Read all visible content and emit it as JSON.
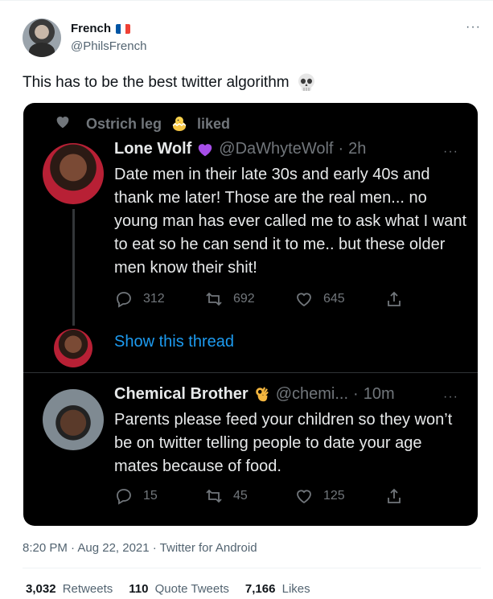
{
  "author": {
    "name": "French",
    "handle": "@PhilsFrench",
    "more": "···"
  },
  "tweet": {
    "text": "This has to be the best twitter algorithm"
  },
  "embedded": {
    "liked": {
      "user": "Ostrich leg",
      "action": "liked"
    },
    "first": {
      "name": "Lone Wolf",
      "handle": "@DaWhyteWolf",
      "dot": "·",
      "time": "2h",
      "more": "···",
      "text": "Date men in their late 30s and early 40s and thank me later! Those are the real men... no young man has ever called me to ask what I want to eat so he can send it to me.. but these older men know their shit!",
      "replies": "312",
      "retweets": "692",
      "likes": "645",
      "show_thread": "Show this thread"
    },
    "second": {
      "name": "Chemical Brother",
      "handle": "@chemi...",
      "dot": "·",
      "time": "10m",
      "more": "···",
      "text": "Parents please feed your children so they won’t be on twitter telling people to date your age mates because of food.",
      "replies": "15",
      "retweets": "45",
      "likes": "125"
    }
  },
  "meta": {
    "timestamp": "8:20 PM · Aug 22, 2021 · Twitter for Android"
  },
  "stats": {
    "retweets_count": "3,032",
    "retweets_label": "Retweets",
    "quotes_count": "110",
    "quotes_label": "Quote Tweets",
    "likes_count": "7,166",
    "likes_label": "Likes"
  },
  "colors": {
    "accent": "#1d9bf0",
    "dark_bg": "#000000",
    "muted": "#536471"
  },
  "icons": [
    "flag-france-icon",
    "skull-emoji-icon",
    "heart-icon",
    "chick-emoji-icon",
    "purple-heart-emoji-icon",
    "ok-hand-emoji-icon",
    "reply-icon",
    "retweet-icon",
    "share-icon",
    "more-icon"
  ]
}
